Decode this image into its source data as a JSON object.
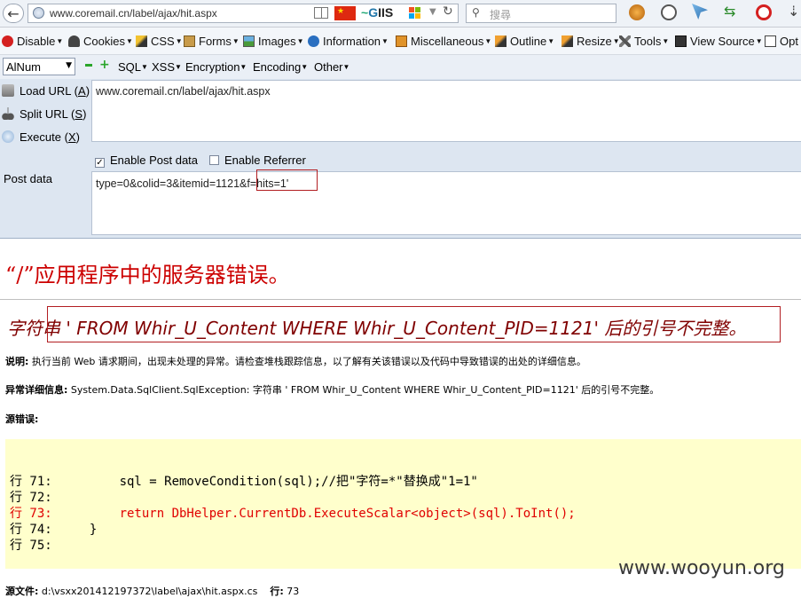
{
  "browser": {
    "back_icon": "back-arrow-icon",
    "url": "www.coremail.cn/label/ajax/hit.aspx",
    "giis_prefix": "G",
    "giis_suffix": "IIS",
    "search_placeholder": "搜尋",
    "flag_glyph": "★"
  },
  "webdev_toolbar": {
    "items": [
      "Disable",
      "Cookies",
      "CSS",
      "Forms",
      "Images",
      "Information",
      "Miscellaneous",
      "Outline",
      "Resize",
      "Tools",
      "View Source",
      "Opt"
    ]
  },
  "hackbar": {
    "encoding_select": "AlNum",
    "menus": [
      "SQL",
      "XSS",
      "Encryption",
      "Encoding",
      "Other"
    ],
    "actions": [
      {
        "label": "Load URL",
        "key": "A"
      },
      {
        "label": "Split URL",
        "key": "S"
      },
      {
        "label": "Execute",
        "key": "X"
      }
    ],
    "url_value": "www.coremail.cn/label/ajax/hit.aspx",
    "enable_post": "Enable Post data",
    "enable_post_checked": true,
    "enable_referrer": "Enable Referrer",
    "enable_referrer_checked": false,
    "post_label": "Post data",
    "post_value": "type=0&colid=3&itemid=1121&f=hits=1'"
  },
  "error_page": {
    "title": "“/”应用程序中的服务器错误。",
    "heading": "字符串 '  FROM Whir_U_Content WHERE Whir_U_Content_PID=1121' 后的引号不完整。",
    "description_label": "说明:",
    "description_text": " 执行当前 Web 请求期间，出现未处理的异常。请检查堆栈跟踪信息，以了解有关该错误以及代码中导致错误的出处的详细信息。",
    "exception_label": "异常详细信息:",
    "exception_text": " System.Data.SqlClient.SqlException: 字符串 '  FROM Whir_U_Content WHERE Whir_U_Content_PID=1121' 后的引号不完整。",
    "source_error_label": "源错误:",
    "code_lines": [
      "行 71:         sql = RemoveCondition(sql);//把\"字符=*\"替换成\"1=1\"",
      "行 72:",
      "行 73:         return DbHelper.CurrentDb.ExecuteScalar<object>(sql).ToInt();",
      "行 74:     }",
      "行 75:"
    ],
    "source_file_label": "源文件:",
    "source_file_value": " d:\\vsxx201412197372\\label\\ajax\\hit.aspx.cs",
    "line_label": "行:",
    "line_value": " 73"
  },
  "watermark": "www.wooyun.org",
  "colors": {
    "error_red": "#cc0000",
    "heading_maroon": "#800000",
    "code_bg": "#ffffcc",
    "highlight_box": "#b21e22"
  }
}
